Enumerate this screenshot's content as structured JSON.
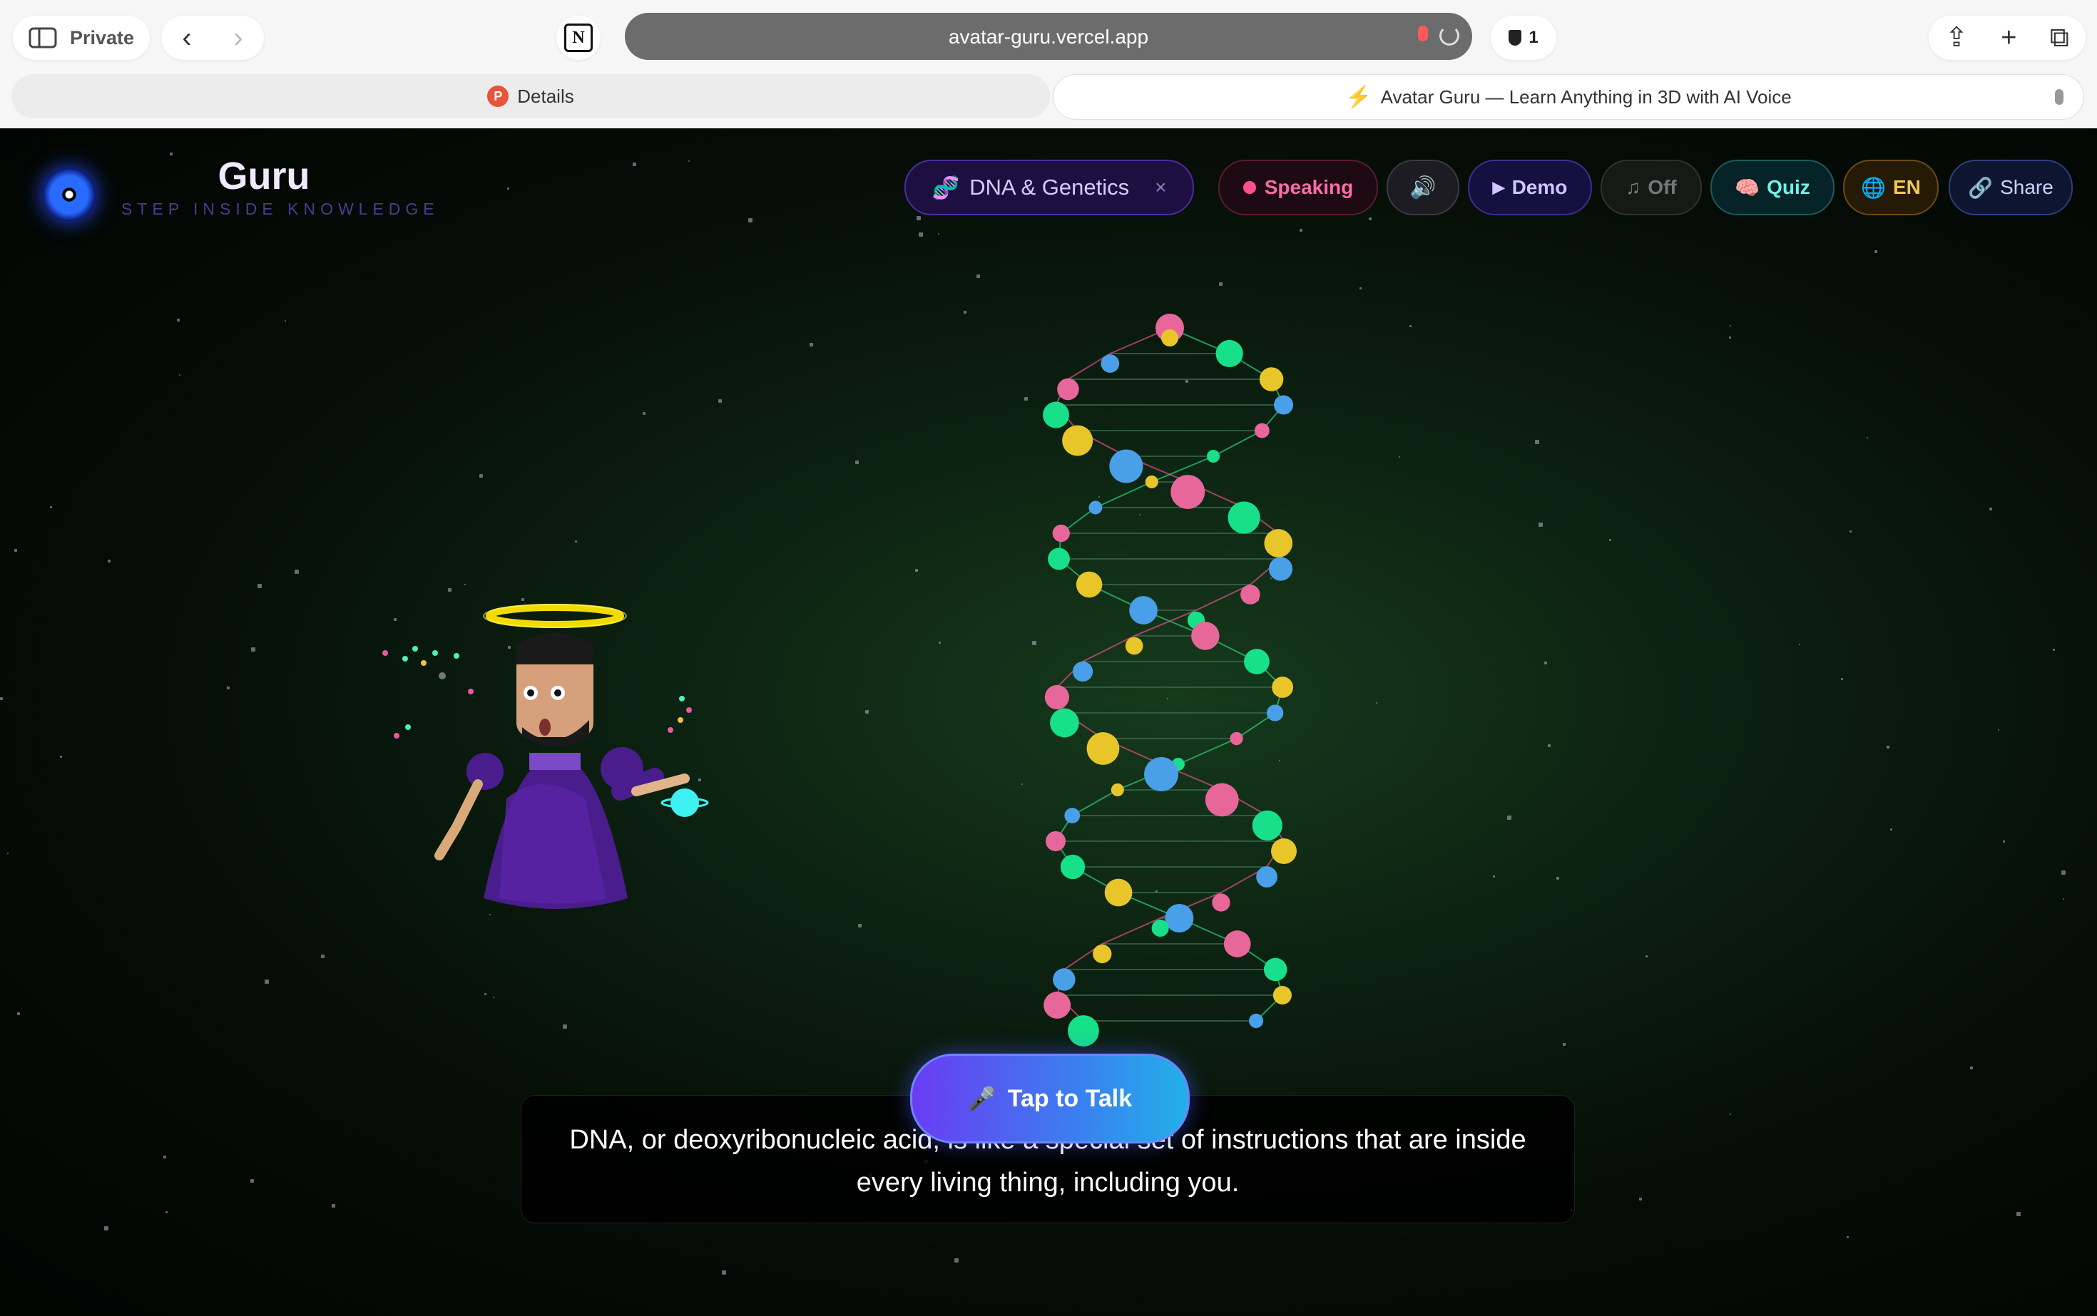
{
  "browser": {
    "private_label": "Private",
    "url": "avatar-guru.vercel.app",
    "shield_count": "1",
    "tabs": [
      {
        "title": "Details",
        "favicon": "P"
      },
      {
        "title": "Avatar Guru — Learn Anything in 3D with AI Voice",
        "favicon": "bolt-icon"
      }
    ]
  },
  "app": {
    "name": "Guru",
    "tagline": "STEP INSIDE KNOWLEDGE",
    "topic_pill": {
      "label": "DNA & Genetics",
      "close": "×",
      "icon": "dna-icon"
    },
    "controls": [
      {
        "label": "Speaking",
        "icon": "recording-dot"
      },
      {
        "label": "",
        "icon": "speaker-icon"
      },
      {
        "label": "Demo",
        "icon": "play-icon"
      },
      {
        "label": "Off",
        "icon": "music-note-icon"
      },
      {
        "label": "Quiz",
        "icon": "brain-icon"
      },
      {
        "label": "EN",
        "icon": "globe-icon"
      },
      {
        "label": "Share",
        "icon": "link-icon"
      }
    ],
    "talk_button": {
      "label": "Tap to Talk",
      "icon": "microphone-icon"
    },
    "caption": "DNA, or deoxyribonucleic acid, is like a special set of instructions that are inside every living thing, including you."
  },
  "colors": {
    "accent_purple": "#6a3cf2",
    "accent_blue": "#22b0e8",
    "speaking": "#ff4f8f",
    "dna_pink": "#e8679a",
    "dna_green": "#18e08a",
    "dna_yellow": "#e8c62a",
    "dna_blue": "#4aa0e8"
  }
}
